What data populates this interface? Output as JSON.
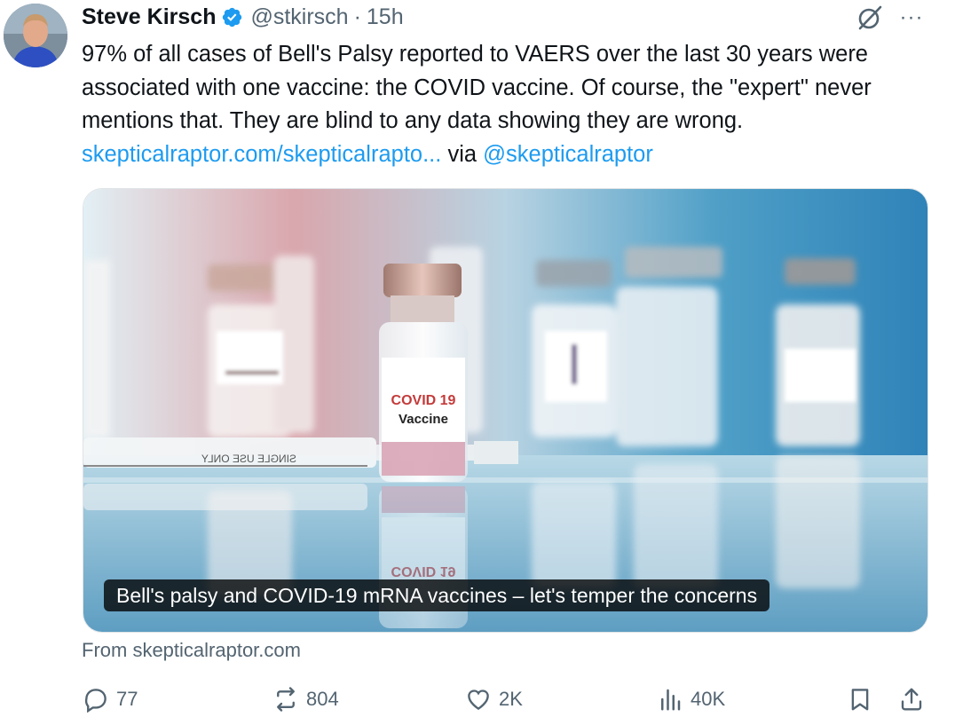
{
  "tweet": {
    "author_name": "Steve Kirsch",
    "handle": "@stkirsch",
    "separator": "·",
    "time": "15h",
    "text_main": "97% of all cases of Bell's Palsy reported to VAERS over the last 30 years were associated with one vaccine: the COVID vaccine. Of course, the \"expert\" never mentions that. They are blind to any data showing they are wrong. ",
    "link_text": "skepticalraptor.com/skepticalrapto...",
    "via_text": " via ",
    "mention_text": "@skepticalraptor",
    "more_icon": "···"
  },
  "card": {
    "caption": "Bell's palsy and COVID-19 mRNA vaccines – let's temper the concerns",
    "vial_label_line1": "COVID 19",
    "vial_label_line2": "Vaccine",
    "syringe_text": "SINGLE USE ONLY",
    "source": "From skepticalraptor.com"
  },
  "actions": {
    "replies": "77",
    "reposts": "804",
    "likes": "2K",
    "views": "40K"
  },
  "colors": {
    "link": "#1d9bf0",
    "muted": "#536471",
    "verified": "#1d9bf0"
  }
}
